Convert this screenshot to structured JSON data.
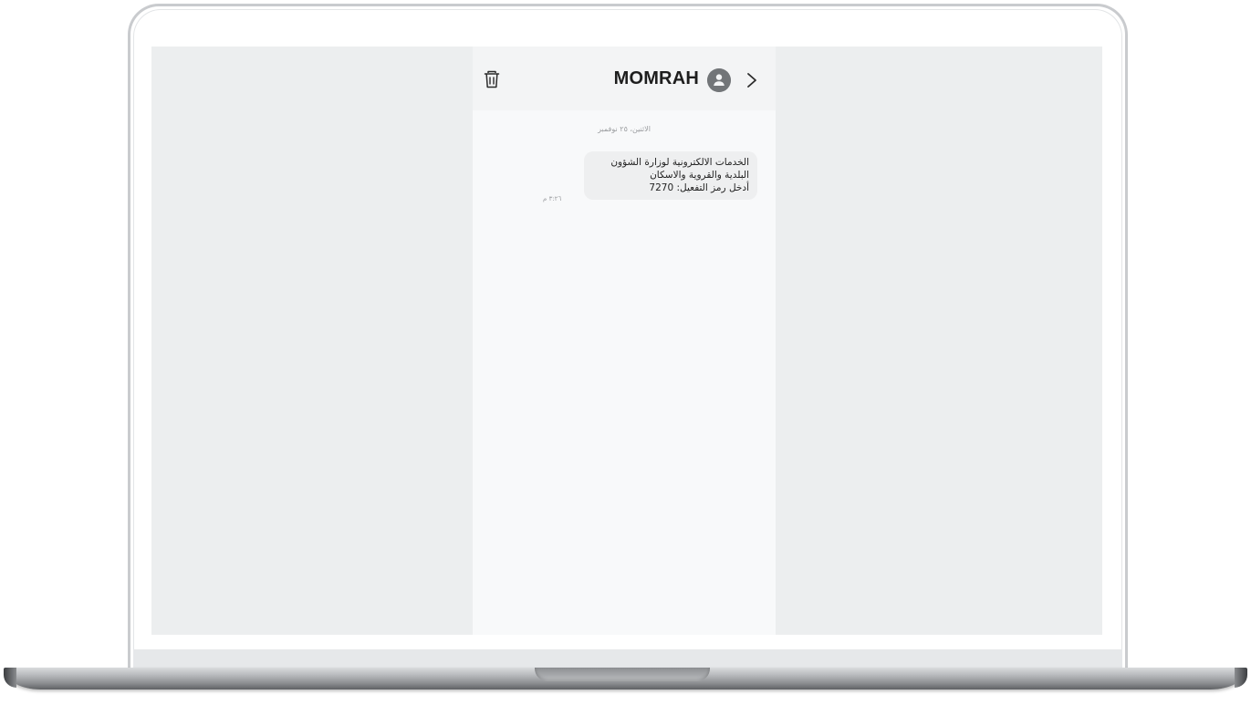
{
  "conversation": {
    "sender": "MOMRAH",
    "date_header": "الاثنين، ٢٥ نوفمبر",
    "messages": [
      {
        "lines": [
          "الخدمات الالكترونية لوزارة الشؤون",
          "البلدية والقروية والاسكان",
          "أدخل رمز التفعيل: 7270"
        ],
        "time": "٣:٢٦ م"
      }
    ]
  },
  "icons": {
    "delete": "trash-icon",
    "contact": "person-avatar-icon",
    "navigate": "chevron-right-icon"
  },
  "colors": {
    "screen_background": "#eceeef",
    "panel_background": "#f8f9fa",
    "header_background": "#f3f4f5",
    "bubble_background": "#eeeff0",
    "avatar": "#727578"
  }
}
